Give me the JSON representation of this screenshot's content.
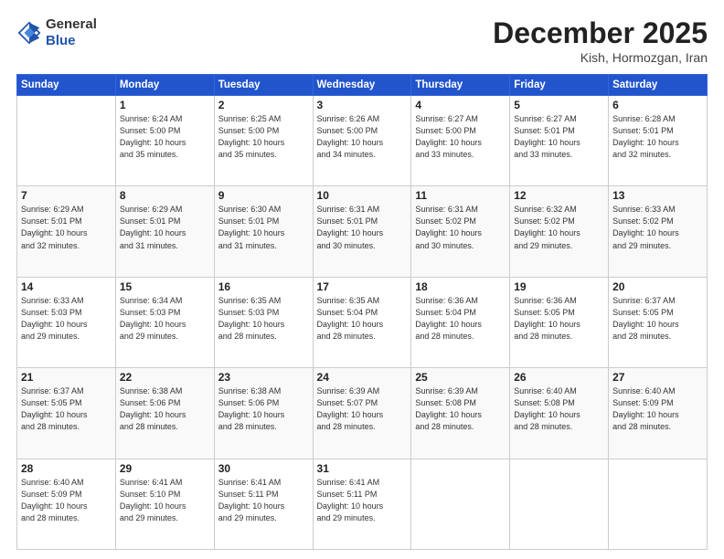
{
  "header": {
    "logo_general": "General",
    "logo_blue": "Blue",
    "month": "December 2025",
    "location": "Kish, Hormozgan, Iran"
  },
  "days_of_week": [
    "Sunday",
    "Monday",
    "Tuesday",
    "Wednesday",
    "Thursday",
    "Friday",
    "Saturday"
  ],
  "weeks": [
    [
      {
        "day": "",
        "info": ""
      },
      {
        "day": "1",
        "info": "Sunrise: 6:24 AM\nSunset: 5:00 PM\nDaylight: 10 hours\nand 35 minutes."
      },
      {
        "day": "2",
        "info": "Sunrise: 6:25 AM\nSunset: 5:00 PM\nDaylight: 10 hours\nand 35 minutes."
      },
      {
        "day": "3",
        "info": "Sunrise: 6:26 AM\nSunset: 5:00 PM\nDaylight: 10 hours\nand 34 minutes."
      },
      {
        "day": "4",
        "info": "Sunrise: 6:27 AM\nSunset: 5:00 PM\nDaylight: 10 hours\nand 33 minutes."
      },
      {
        "day": "5",
        "info": "Sunrise: 6:27 AM\nSunset: 5:01 PM\nDaylight: 10 hours\nand 33 minutes."
      },
      {
        "day": "6",
        "info": "Sunrise: 6:28 AM\nSunset: 5:01 PM\nDaylight: 10 hours\nand 32 minutes."
      }
    ],
    [
      {
        "day": "7",
        "info": "Sunrise: 6:29 AM\nSunset: 5:01 PM\nDaylight: 10 hours\nand 32 minutes."
      },
      {
        "day": "8",
        "info": "Sunrise: 6:29 AM\nSunset: 5:01 PM\nDaylight: 10 hours\nand 31 minutes."
      },
      {
        "day": "9",
        "info": "Sunrise: 6:30 AM\nSunset: 5:01 PM\nDaylight: 10 hours\nand 31 minutes."
      },
      {
        "day": "10",
        "info": "Sunrise: 6:31 AM\nSunset: 5:01 PM\nDaylight: 10 hours\nand 30 minutes."
      },
      {
        "day": "11",
        "info": "Sunrise: 6:31 AM\nSunset: 5:02 PM\nDaylight: 10 hours\nand 30 minutes."
      },
      {
        "day": "12",
        "info": "Sunrise: 6:32 AM\nSunset: 5:02 PM\nDaylight: 10 hours\nand 29 minutes."
      },
      {
        "day": "13",
        "info": "Sunrise: 6:33 AM\nSunset: 5:02 PM\nDaylight: 10 hours\nand 29 minutes."
      }
    ],
    [
      {
        "day": "14",
        "info": "Sunrise: 6:33 AM\nSunset: 5:03 PM\nDaylight: 10 hours\nand 29 minutes."
      },
      {
        "day": "15",
        "info": "Sunrise: 6:34 AM\nSunset: 5:03 PM\nDaylight: 10 hours\nand 29 minutes."
      },
      {
        "day": "16",
        "info": "Sunrise: 6:35 AM\nSunset: 5:03 PM\nDaylight: 10 hours\nand 28 minutes."
      },
      {
        "day": "17",
        "info": "Sunrise: 6:35 AM\nSunset: 5:04 PM\nDaylight: 10 hours\nand 28 minutes."
      },
      {
        "day": "18",
        "info": "Sunrise: 6:36 AM\nSunset: 5:04 PM\nDaylight: 10 hours\nand 28 minutes."
      },
      {
        "day": "19",
        "info": "Sunrise: 6:36 AM\nSunset: 5:05 PM\nDaylight: 10 hours\nand 28 minutes."
      },
      {
        "day": "20",
        "info": "Sunrise: 6:37 AM\nSunset: 5:05 PM\nDaylight: 10 hours\nand 28 minutes."
      }
    ],
    [
      {
        "day": "21",
        "info": "Sunrise: 6:37 AM\nSunset: 5:05 PM\nDaylight: 10 hours\nand 28 minutes."
      },
      {
        "day": "22",
        "info": "Sunrise: 6:38 AM\nSunset: 5:06 PM\nDaylight: 10 hours\nand 28 minutes."
      },
      {
        "day": "23",
        "info": "Sunrise: 6:38 AM\nSunset: 5:06 PM\nDaylight: 10 hours\nand 28 minutes."
      },
      {
        "day": "24",
        "info": "Sunrise: 6:39 AM\nSunset: 5:07 PM\nDaylight: 10 hours\nand 28 minutes."
      },
      {
        "day": "25",
        "info": "Sunrise: 6:39 AM\nSunset: 5:08 PM\nDaylight: 10 hours\nand 28 minutes."
      },
      {
        "day": "26",
        "info": "Sunrise: 6:40 AM\nSunset: 5:08 PM\nDaylight: 10 hours\nand 28 minutes."
      },
      {
        "day": "27",
        "info": "Sunrise: 6:40 AM\nSunset: 5:09 PM\nDaylight: 10 hours\nand 28 minutes."
      }
    ],
    [
      {
        "day": "28",
        "info": "Sunrise: 6:40 AM\nSunset: 5:09 PM\nDaylight: 10 hours\nand 28 minutes."
      },
      {
        "day": "29",
        "info": "Sunrise: 6:41 AM\nSunset: 5:10 PM\nDaylight: 10 hours\nand 29 minutes."
      },
      {
        "day": "30",
        "info": "Sunrise: 6:41 AM\nSunset: 5:11 PM\nDaylight: 10 hours\nand 29 minutes."
      },
      {
        "day": "31",
        "info": "Sunrise: 6:41 AM\nSunset: 5:11 PM\nDaylight: 10 hours\nand 29 minutes."
      },
      {
        "day": "",
        "info": ""
      },
      {
        "day": "",
        "info": ""
      },
      {
        "day": "",
        "info": ""
      }
    ]
  ]
}
